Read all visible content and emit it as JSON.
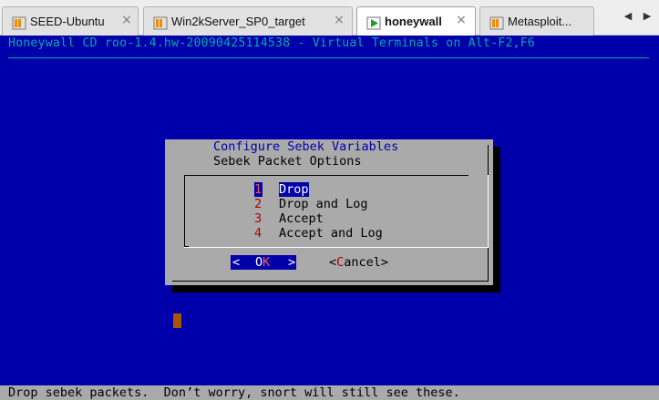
{
  "tabs": [
    {
      "label": "SEED-Ubuntu",
      "active": false
    },
    {
      "label": "Win2kServer_SP0_target",
      "active": false
    },
    {
      "label": "honeywall",
      "active": true
    },
    {
      "label": "Metasploit...",
      "active": false
    }
  ],
  "tab_close_glyph": "×",
  "nav": {
    "prev": "◀",
    "next": "▶"
  },
  "console": {
    "backtitle": "Honeywall CD roo-1.4.hw-20090425114538 - Virtual Terminals on Alt-F2,F6",
    "dialog": {
      "title": "Configure Sebek Variables",
      "subtitle": "Sebek Packet Options",
      "items": [
        {
          "key": "1",
          "label": "Drop",
          "selected": true
        },
        {
          "key": "2",
          "label": "Drop and Log",
          "selected": false
        },
        {
          "key": "3",
          "label": "Accept",
          "selected": false
        },
        {
          "key": "4",
          "label": "Accept and Log",
          "selected": false
        }
      ],
      "ok_button": {
        "left": "<",
        "o": "O",
        "k": "K",
        "right": ">"
      },
      "cancel_button": {
        "left": "<",
        "hot": "C",
        "rest": "ancel>"
      }
    },
    "status": "Drop sebek packets.  Don’t worry, snort will still see these."
  },
  "colors": {
    "console_bg": "#0000aa",
    "dialog_bg": "#aaaaaa",
    "backtitle": "#00a8a8",
    "hotkey": "#aa0000",
    "cursor": "#aa5500"
  }
}
